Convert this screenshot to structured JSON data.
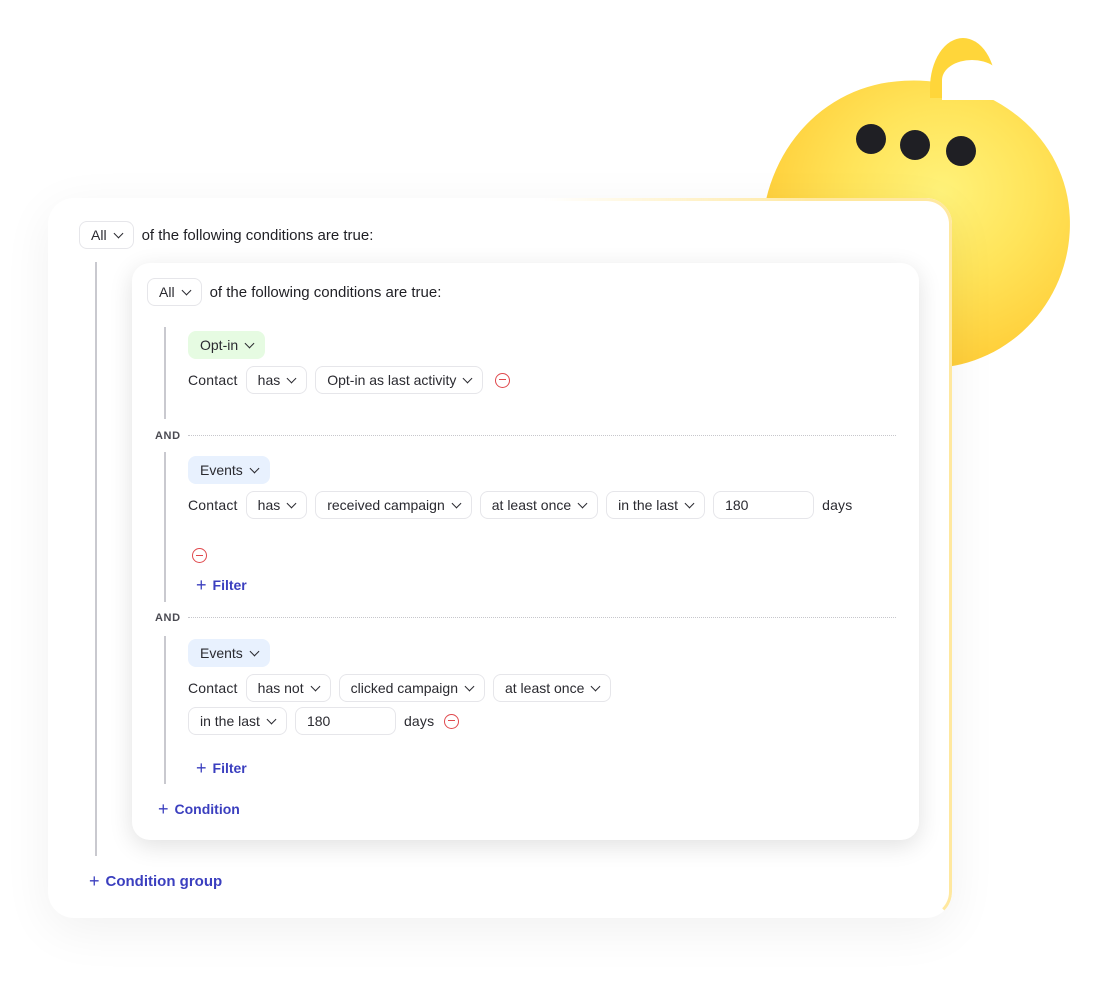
{
  "root": {
    "quantifier": "All",
    "suffix": "of the following conditions are true:",
    "add_group_label": "Condition group"
  },
  "group": {
    "quantifier": "All",
    "suffix": "of the following conditions are true:",
    "add_condition_label": "Condition",
    "connector": "AND",
    "conditions": [
      {
        "category": "Opt-in",
        "subject": "Contact",
        "operator": "has",
        "field": "Opt-in as last activity"
      },
      {
        "category": "Events",
        "subject": "Contact",
        "operator": "has",
        "event": "received campaign",
        "frequency": "at least once",
        "timeframe": "in the last",
        "amount": "180",
        "unit": "days",
        "add_filter_label": "Filter"
      },
      {
        "category": "Events",
        "subject": "Contact",
        "operator": "has not",
        "event": "clicked campaign",
        "frequency": "at least once",
        "timeframe": "in the last",
        "amount": "180",
        "unit": "days",
        "add_filter_label": "Filter"
      }
    ]
  },
  "icons": {
    "chevron": "chevron-down-icon",
    "remove": "remove-circle-icon",
    "add": "plus-icon"
  },
  "colors": {
    "accent": "#3b3fbf",
    "danger": "#e0494d",
    "optin_tag": "#e6fbe2",
    "events_tag": "#e8f1fe",
    "blob": "#ffd63a"
  }
}
